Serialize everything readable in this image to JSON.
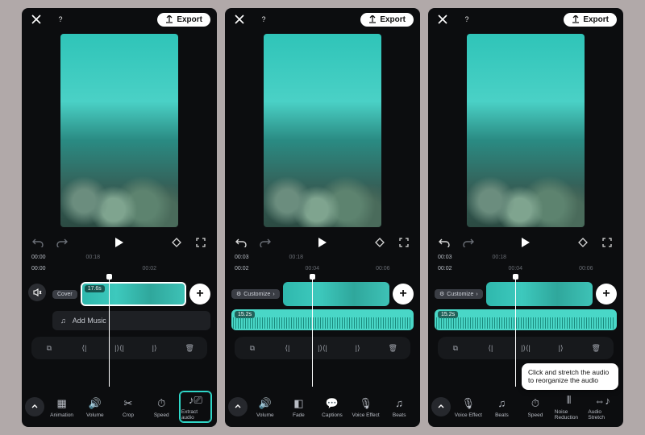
{
  "common": {
    "export_label": "Export",
    "add_music_label": "Add Music"
  },
  "panels": [
    {
      "timecodes": [
        "00:00",
        "00:18"
      ],
      "ruler": [
        "00:00",
        "00:02"
      ],
      "clip_duration": "17.6s",
      "cover_chip": "Cover",
      "dock": [
        {
          "name": "animation",
          "label": "Animation"
        },
        {
          "name": "volume",
          "label": "Volume"
        },
        {
          "name": "crop",
          "label": "Crop"
        },
        {
          "name": "speed",
          "label": "Speed"
        },
        {
          "name": "extract-audio",
          "label": "Extract audio",
          "highlight": true
        }
      ],
      "show_add_music": true,
      "show_audio_clip": false
    },
    {
      "timecodes": [
        "00:03",
        "00:18"
      ],
      "ruler": [
        "00:02",
        "00:04",
        "00:06"
      ],
      "customize_chip": "Customize",
      "audio_duration": "15.2s",
      "dock": [
        {
          "name": "volume",
          "label": "Volume"
        },
        {
          "name": "fade",
          "label": "Fade"
        },
        {
          "name": "captions",
          "label": "Captions"
        },
        {
          "name": "voice-effect",
          "label": "Voice Effect"
        },
        {
          "name": "beats",
          "label": "Beats"
        }
      ],
      "show_add_music": false,
      "show_audio_clip": true
    },
    {
      "timecodes": [
        "00:03",
        "00:18"
      ],
      "ruler": [
        "00:02",
        "00:04",
        "00:06"
      ],
      "customize_chip": "Customize",
      "audio_duration": "15.2s",
      "dock": [
        {
          "name": "voice-effect",
          "label": "Voice Effect"
        },
        {
          "name": "beats",
          "label": "Beats"
        },
        {
          "name": "speed",
          "label": "Speed"
        },
        {
          "name": "noise-reduction",
          "label": "Noise Reduction"
        },
        {
          "name": "audio-stretch",
          "label": "Audio Stretch"
        }
      ],
      "show_add_music": false,
      "show_audio_clip": true,
      "tooltip": "Click and stretch the audio to reorganize the audio"
    }
  ]
}
